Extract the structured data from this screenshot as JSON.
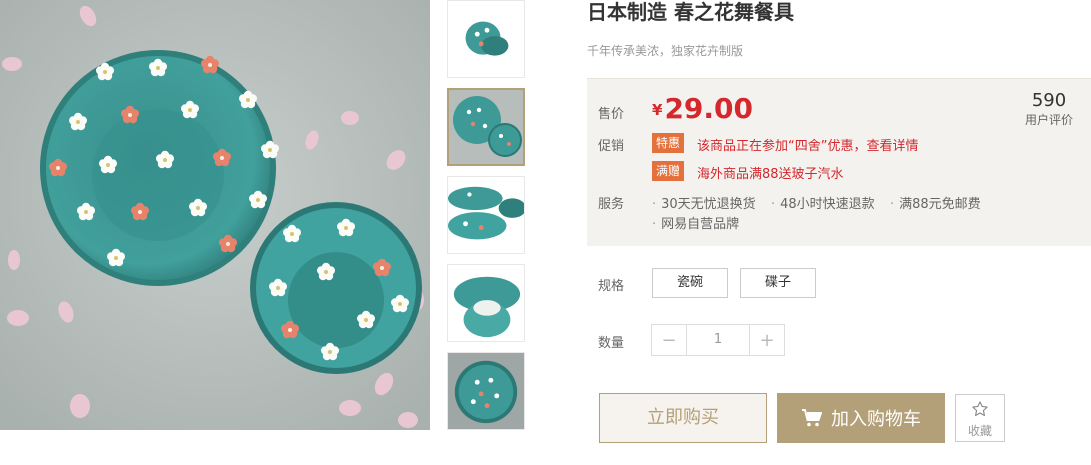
{
  "product": {
    "title": "日本制造 春之花舞餐具",
    "subtitle": "千年传承美浓，独家花卉制版"
  },
  "gallery": {
    "main_alt": "product-photo-bowls",
    "active_index": 1,
    "thumbnails": [
      "thumb-bowl-stack",
      "thumb-bowls-top",
      "thumb-bowls-side",
      "thumb-bowl-bottom",
      "thumb-bowl-flowers"
    ]
  },
  "price_box": {
    "price_label": "售价",
    "currency": "¥",
    "price": "29.00",
    "review_count": "590",
    "review_label": "用户评价",
    "promo_label": "促销",
    "promos": [
      {
        "tag": "特惠",
        "text": "该商品正在参加“四舍”优惠，查看详情"
      },
      {
        "tag": "满赠",
        "text": "海外商品满88送玻子汽水"
      }
    ],
    "service_label": "服务",
    "services": [
      "30天无忧退换货",
      "48小时快速退款",
      "满88元免邮费",
      "网易自营品牌"
    ]
  },
  "spec": {
    "label": "规格",
    "options": [
      "瓷碗",
      "碟子"
    ]
  },
  "quantity": {
    "label": "数量",
    "value": "1",
    "minus": "−",
    "plus": "+"
  },
  "actions": {
    "buy_now": "立即购买",
    "add_to_cart": "加入购物车",
    "favorite": "收藏"
  },
  "colors": {
    "accent": "#b4a078",
    "price_red": "#d4282d",
    "promo_tag": "#e4703c",
    "bowl_teal": "#3d9a96"
  }
}
